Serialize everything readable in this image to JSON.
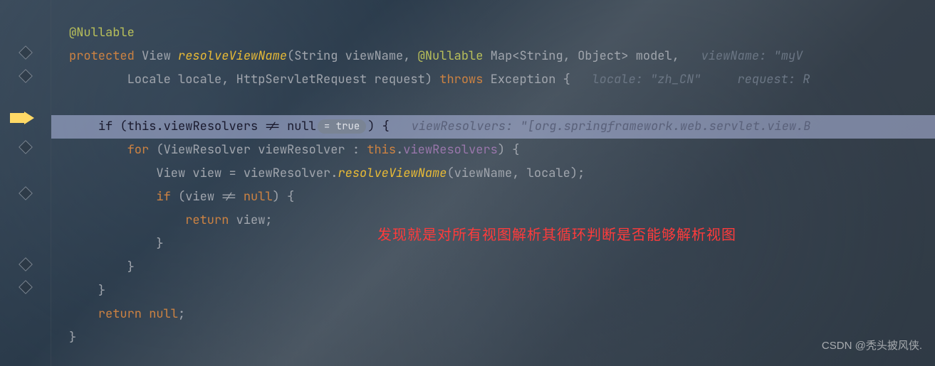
{
  "code": {
    "l1_anno": "@Nullable",
    "l2_kw1": "protected",
    "l2_type1": "View",
    "l2_method": "resolveViewName",
    "l2_p1t": "String",
    "l2_p1n": "viewName",
    "l2_anno": "@Nullable",
    "l2_p2t": "Map",
    "l2_p2g": "<String, Object>",
    "l2_p2n": "model",
    "l2_hint": "viewName: \"myV",
    "l3_p1t": "Locale",
    "l3_p1n": "locale",
    "l3_p2t": "HttpServletRequest",
    "l3_p2n": "request",
    "l3_kw": "throws",
    "l3_exc": "Exception",
    "l3_brace": "{",
    "l3_hint1": "locale: \"zh_CN\"",
    "l3_hint2": "request: R",
    "l4_kw": "if",
    "l4_this": "this",
    "l4_field": "viewResolvers",
    "l4_op": "!=",
    "l4_null": "null",
    "l4_pill": "= true",
    "l4_brace": ") {",
    "l4_hint": "viewResolvers: \"[org.springframework.web.servlet.view.B",
    "l5_kw": "for",
    "l5_type": "ViewResolver",
    "l5_var": "viewResolver",
    "l5_this": "this",
    "l5_field": "viewResolvers",
    "l5_brace": ") {",
    "l6_type": "View",
    "l6_var": "view",
    "l6_obj": "viewResolver",
    "l6_method": "resolveViewName",
    "l6_arg1": "viewName",
    "l6_arg2": "locale",
    "l7_kw": "if",
    "l7_var": "view",
    "l7_op": "!=",
    "l7_null": "null",
    "l7_brace": ") {",
    "l8_kw": "return",
    "l8_var": "view",
    "l9_brace": "}",
    "l10_brace": "}",
    "l11_brace": "}",
    "l12_kw": "return",
    "l12_null": "null",
    "l13_brace": "}"
  },
  "annotation_text": "发现就是对所有视图解析其循环判断是否能够解析视图",
  "watermark": "CSDN @秃头披风侠.",
  "colors": {
    "keyword": "#cc8242",
    "annotation": "#b8bf5a",
    "method": "#e8ba36",
    "field": "#9876aa",
    "exec_highlight": "#b4bee6",
    "red_note": "#ff3b3b"
  }
}
